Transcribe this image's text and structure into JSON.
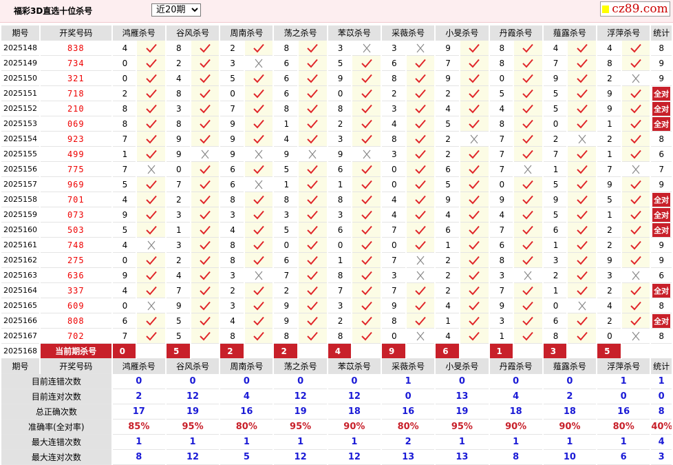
{
  "header": {
    "title": "福彩3D直选十位杀号",
    "select_value": "近20期",
    "logo_text": "cz89.com"
  },
  "table": {
    "col_headers": [
      "期号",
      "开奖号码",
      "鸿雁杀号",
      "谷风杀号",
      "周南杀号",
      "荡之杀号",
      "苯苡杀号",
      "采薇杀号",
      "小旻杀号",
      "丹霞杀号",
      "薤露杀号",
      "浮萍杀号",
      "统计"
    ],
    "rows": [
      {
        "p": "2025148",
        "d": "838",
        "n": [
          "4",
          "8",
          "2",
          "8",
          "3",
          "3",
          "9",
          "8",
          "4",
          "4"
        ],
        "r": [
          1,
          1,
          1,
          1,
          0,
          0,
          1,
          1,
          1,
          1
        ],
        "c": "8"
      },
      {
        "p": "2025149",
        "d": "734",
        "n": [
          "0",
          "2",
          "3",
          "6",
          "5",
          "6",
          "7",
          "8",
          "7",
          "8"
        ],
        "r": [
          1,
          1,
          0,
          1,
          1,
          1,
          1,
          1,
          1,
          1
        ],
        "c": "9"
      },
      {
        "p": "2025150",
        "d": "321",
        "n": [
          "0",
          "4",
          "5",
          "6",
          "9",
          "8",
          "9",
          "0",
          "9",
          "2"
        ],
        "r": [
          1,
          1,
          1,
          1,
          1,
          1,
          1,
          1,
          1,
          0
        ],
        "c": "9"
      },
      {
        "p": "2025151",
        "d": "718",
        "n": [
          "2",
          "8",
          "0",
          "6",
          "0",
          "2",
          "2",
          "5",
          "5",
          "9"
        ],
        "r": [
          1,
          1,
          1,
          1,
          1,
          1,
          1,
          1,
          1,
          1
        ],
        "c": "全对"
      },
      {
        "p": "2025152",
        "d": "210",
        "n": [
          "8",
          "3",
          "7",
          "8",
          "8",
          "3",
          "4",
          "4",
          "5",
          "9"
        ],
        "r": [
          1,
          1,
          1,
          1,
          1,
          1,
          1,
          1,
          1,
          1
        ],
        "c": "全对"
      },
      {
        "p": "2025153",
        "d": "069",
        "n": [
          "8",
          "8",
          "9",
          "1",
          "2",
          "4",
          "5",
          "8",
          "0",
          "1"
        ],
        "r": [
          1,
          1,
          1,
          1,
          1,
          1,
          1,
          1,
          1,
          1
        ],
        "c": "全对"
      },
      {
        "p": "2025154",
        "d": "923",
        "n": [
          "7",
          "9",
          "9",
          "4",
          "3",
          "8",
          "2",
          "7",
          "2",
          "2"
        ],
        "r": [
          1,
          1,
          1,
          1,
          1,
          1,
          0,
          1,
          0,
          1
        ],
        "c": "8"
      },
      {
        "p": "2025155",
        "d": "499",
        "n": [
          "1",
          "9",
          "9",
          "9",
          "9",
          "3",
          "2",
          "7",
          "7",
          "1"
        ],
        "r": [
          1,
          0,
          0,
          0,
          0,
          1,
          1,
          1,
          1,
          1
        ],
        "c": "6"
      },
      {
        "p": "2025156",
        "d": "775",
        "n": [
          "7",
          "0",
          "6",
          "5",
          "6",
          "0",
          "6",
          "7",
          "1",
          "7"
        ],
        "r": [
          0,
          1,
          1,
          1,
          1,
          1,
          1,
          0,
          1,
          0
        ],
        "c": "7"
      },
      {
        "p": "2025157",
        "d": "969",
        "n": [
          "5",
          "7",
          "6",
          "1",
          "1",
          "0",
          "5",
          "0",
          "5",
          "9"
        ],
        "r": [
          1,
          1,
          0,
          1,
          1,
          1,
          1,
          1,
          1,
          1
        ],
        "c": "9"
      },
      {
        "p": "2025158",
        "d": "701",
        "n": [
          "4",
          "2",
          "8",
          "8",
          "8",
          "4",
          "9",
          "9",
          "9",
          "5"
        ],
        "r": [
          1,
          1,
          1,
          1,
          1,
          1,
          1,
          1,
          1,
          1
        ],
        "c": "全对"
      },
      {
        "p": "2025159",
        "d": "073",
        "n": [
          "9",
          "3",
          "3",
          "3",
          "3",
          "4",
          "4",
          "4",
          "5",
          "1"
        ],
        "r": [
          1,
          1,
          1,
          1,
          1,
          1,
          1,
          1,
          1,
          1
        ],
        "c": "全对"
      },
      {
        "p": "2025160",
        "d": "503",
        "n": [
          "5",
          "1",
          "4",
          "5",
          "6",
          "7",
          "6",
          "7",
          "6",
          "2"
        ],
        "r": [
          1,
          1,
          1,
          1,
          1,
          1,
          1,
          1,
          1,
          1
        ],
        "c": "全对"
      },
      {
        "p": "2025161",
        "d": "748",
        "n": [
          "4",
          "3",
          "8",
          "0",
          "0",
          "0",
          "1",
          "6",
          "1",
          "2"
        ],
        "r": [
          0,
          1,
          1,
          1,
          1,
          1,
          1,
          1,
          1,
          1
        ],
        "c": "9"
      },
      {
        "p": "2025162",
        "d": "275",
        "n": [
          "0",
          "2",
          "8",
          "6",
          "1",
          "7",
          "2",
          "8",
          "3",
          "9"
        ],
        "r": [
          1,
          1,
          1,
          1,
          1,
          0,
          1,
          1,
          1,
          1
        ],
        "c": "9"
      },
      {
        "p": "2025163",
        "d": "636",
        "n": [
          "9",
          "4",
          "3",
          "7",
          "8",
          "3",
          "2",
          "3",
          "2",
          "3"
        ],
        "r": [
          1,
          1,
          0,
          1,
          1,
          0,
          1,
          0,
          1,
          0
        ],
        "c": "6"
      },
      {
        "p": "2025164",
        "d": "337",
        "n": [
          "4",
          "7",
          "2",
          "2",
          "7",
          "7",
          "2",
          "7",
          "1",
          "2"
        ],
        "r": [
          1,
          1,
          1,
          1,
          1,
          1,
          1,
          1,
          1,
          1
        ],
        "c": "全对"
      },
      {
        "p": "2025165",
        "d": "609",
        "n": [
          "0",
          "9",
          "3",
          "9",
          "3",
          "9",
          "4",
          "9",
          "0",
          "4"
        ],
        "r": [
          0,
          1,
          1,
          1,
          1,
          1,
          1,
          1,
          0,
          1
        ],
        "c": "8"
      },
      {
        "p": "2025166",
        "d": "808",
        "n": [
          "6",
          "5",
          "4",
          "9",
          "2",
          "8",
          "1",
          "3",
          "6",
          "2"
        ],
        "r": [
          1,
          1,
          1,
          1,
          1,
          1,
          1,
          1,
          1,
          1
        ],
        "c": "全对"
      },
      {
        "p": "2025167",
        "d": "702",
        "n": [
          "7",
          "5",
          "8",
          "8",
          "8",
          "0",
          "4",
          "1",
          "8",
          "0"
        ],
        "r": [
          1,
          1,
          1,
          1,
          1,
          0,
          1,
          1,
          1,
          0
        ],
        "c": "8"
      }
    ],
    "current": {
      "period": "2025168",
      "label": "当前期杀号",
      "kills": [
        "0",
        "5",
        "2",
        "2",
        "4",
        "9",
        "6",
        "1",
        "3",
        "5"
      ]
    },
    "stats": [
      {
        "label": "目前连错次数",
        "values": [
          "0",
          "0",
          "0",
          "0",
          "0",
          "1",
          "0",
          "0",
          "0",
          "1",
          "1"
        ]
      },
      {
        "label": "目前连对次数",
        "values": [
          "2",
          "12",
          "4",
          "12",
          "12",
          "0",
          "13",
          "4",
          "2",
          "0",
          "0"
        ]
      },
      {
        "label": "总正确次数",
        "values": [
          "17",
          "19",
          "16",
          "19",
          "18",
          "16",
          "19",
          "18",
          "18",
          "16",
          "8"
        ]
      },
      {
        "label": "准确率(全对率)",
        "values": [
          "85%",
          "95%",
          "80%",
          "95%",
          "90%",
          "80%",
          "95%",
          "90%",
          "90%",
          "80%",
          "40%"
        ]
      },
      {
        "label": "最大连错次数",
        "values": [
          "1",
          "1",
          "1",
          "1",
          "1",
          "2",
          "1",
          "1",
          "1",
          "1",
          "4"
        ]
      },
      {
        "label": "最大连对次数",
        "values": [
          "8",
          "12",
          "5",
          "12",
          "12",
          "13",
          "13",
          "8",
          "10",
          "6",
          "3"
        ]
      }
    ]
  }
}
